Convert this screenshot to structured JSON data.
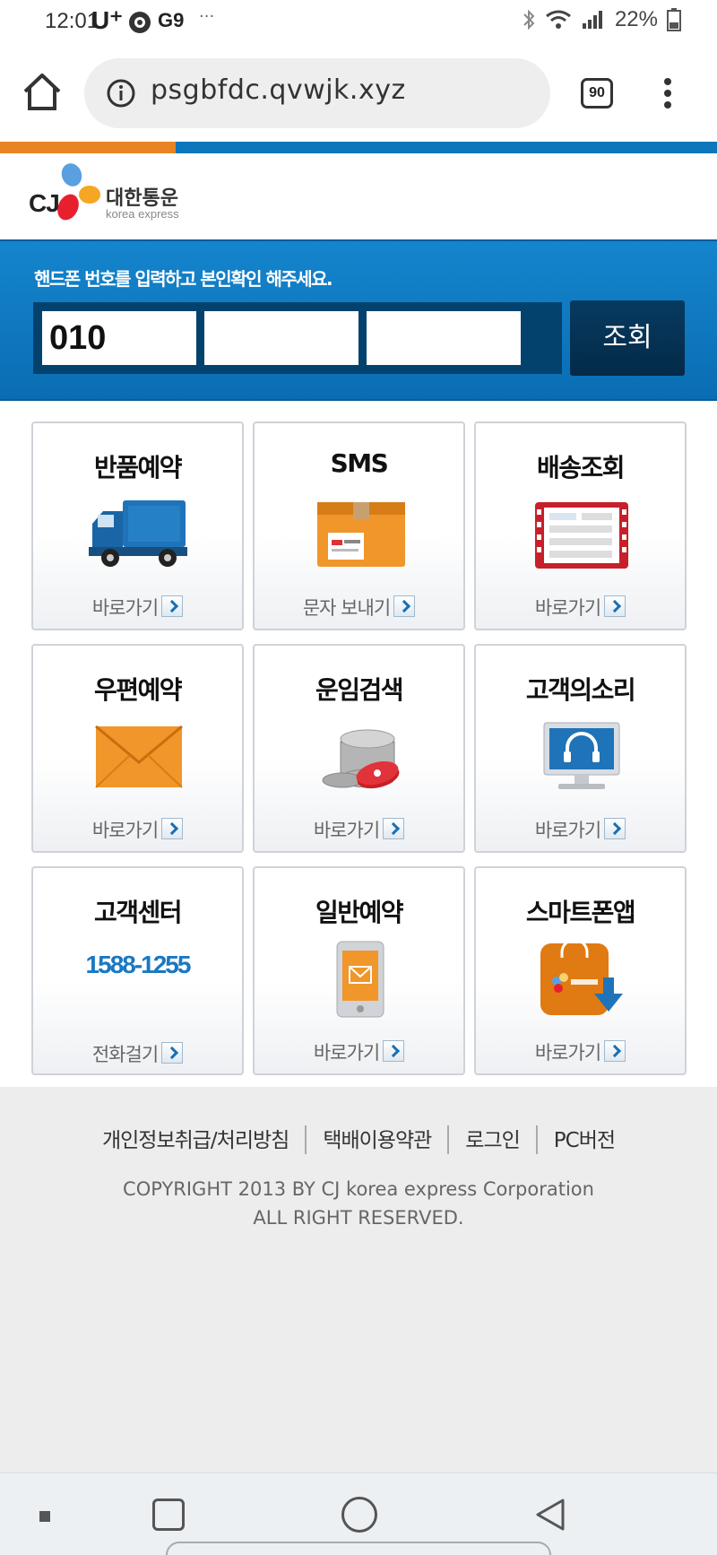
{
  "status_bar": {
    "time": "12:01",
    "carrier": "U⁺",
    "extra": "G9",
    "dots": "···",
    "battery": "22%"
  },
  "browser": {
    "url": "psgbfdc.qvwjk.xyz",
    "tab_count": "90"
  },
  "logo": {
    "brand": "CJ",
    "name": "대한통운",
    "sub": "korea express"
  },
  "phone_form": {
    "prompt": "핸드폰 번호를 입력하고 본인확인 해주세요.",
    "part1": "010",
    "part2": "",
    "part3": "",
    "submit_label": "조회"
  },
  "tiles": [
    {
      "title": "반품예약",
      "link": "바로가기",
      "icon": "truck-icon"
    },
    {
      "title": "SMS",
      "link": "문자 보내기",
      "icon": "box-icon"
    },
    {
      "title": "배송조회",
      "link": "바로가기",
      "icon": "ticket-icon"
    },
    {
      "title": "우편예약",
      "link": "바로가기",
      "icon": "envelope-icon"
    },
    {
      "title": "운임검색",
      "link": "바로가기",
      "icon": "coins-icon"
    },
    {
      "title": "고객의소리",
      "link": "바로가기",
      "icon": "monitor-headset-icon"
    },
    {
      "title": "고객센터",
      "phone": "1588-1255",
      "link": "전화걸기",
      "icon": ""
    },
    {
      "title": "일반예약",
      "link": "바로가기",
      "icon": "phone-mail-icon"
    },
    {
      "title": "스마트폰앱",
      "link": "바로가기",
      "icon": "app-bag-icon"
    }
  ],
  "footer": {
    "links": [
      "개인정보취급/처리방침",
      "택배이용약관",
      "로그인",
      "PC버전"
    ],
    "copyright_1": "COPYRIGHT 2013 BY CJ korea express Corporation",
    "copyright_2": "ALL RIGHT RESERVED."
  },
  "colors": {
    "accent_blue": "#0e76bb",
    "accent_orange": "#e88423",
    "panel_blue": "#1585cd",
    "button_navy": "#042a48",
    "phone_blue": "#1a78c2"
  }
}
